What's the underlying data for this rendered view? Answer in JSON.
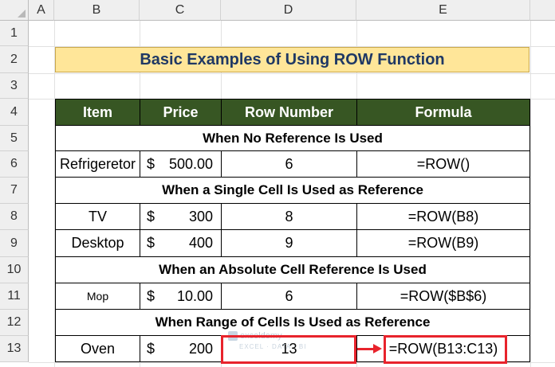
{
  "columns": [
    "A",
    "B",
    "C",
    "D",
    "E"
  ],
  "rows": [
    "1",
    "2",
    "3",
    "4",
    "5",
    "6",
    "7",
    "8",
    "9",
    "10",
    "11",
    "12",
    "13"
  ],
  "title": "Basic Examples of Using ROW Function",
  "headers": {
    "item": "Item",
    "price": "Price",
    "row_number": "Row Number",
    "formula": "Formula"
  },
  "sections": {
    "no_reference": "When No Reference Is Used",
    "single_cell": "When a Single Cell Is Used as Reference",
    "absolute": "When an Absolute Cell Reference Is Used",
    "range": "When Range of Cells Is Used as Reference"
  },
  "data_rows": [
    {
      "item": "Refrigeretor",
      "currency": "$",
      "price": "500.00",
      "row_number": "6",
      "formula": "=ROW()"
    },
    {
      "item": "TV",
      "currency": "$",
      "price": "300",
      "row_number": "8",
      "formula": "=ROW(B8)"
    },
    {
      "item": "Desktop",
      "currency": "$",
      "price": "400",
      "row_number": "9",
      "formula": "=ROW(B9)"
    },
    {
      "item": "Mop",
      "currency": "$",
      "price": "10.00",
      "row_number": "6",
      "formula": "=ROW($B$6)"
    },
    {
      "item": "Oven",
      "currency": "$",
      "price": "200",
      "row_number": "13",
      "formula": "=ROW(B13:C13)"
    }
  ],
  "watermark": {
    "name": "exceldemy",
    "tagline": "EXCEL · DATA · BI"
  },
  "colors": {
    "header_bg": "#375623",
    "title_bg": "#ffe699",
    "title_text": "#1f3864",
    "highlight": "#e8232c"
  }
}
